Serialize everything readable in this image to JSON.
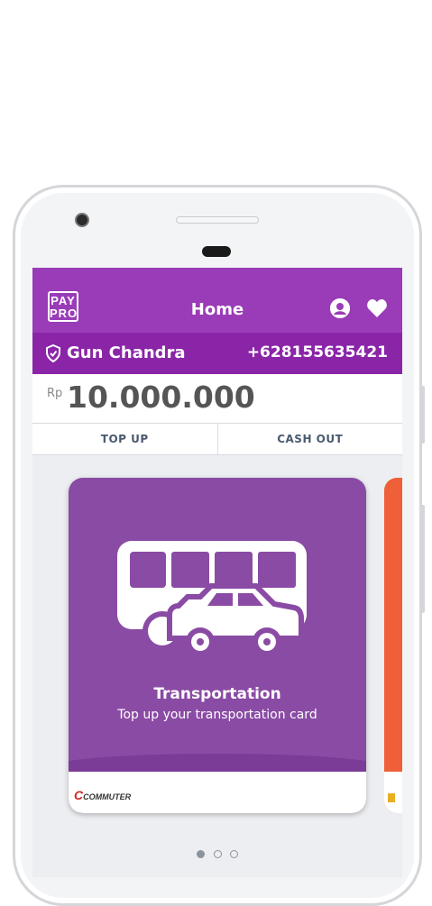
{
  "app": {
    "logo_text_line1": "PAY",
    "logo_text_line2": "PRO",
    "title": "Home",
    "brand_color": "#9a3cb7",
    "icons": [
      "profile-icon",
      "heart-icon",
      "shield-icon"
    ]
  },
  "user": {
    "name": "Gun Chandra",
    "phone": "+628155635421"
  },
  "balance": {
    "currency": "Rp",
    "amount": "10.000.000"
  },
  "actions": {
    "top_up": "TOP UP",
    "cash_out": "CASH OUT"
  },
  "cards": [
    {
      "title": "Transportation",
      "subtitle": "Top up your transportation card",
      "partner_logo": "COMMUTER",
      "color": "#8a4ba4"
    },
    {
      "color": "#ef5f38"
    }
  ],
  "pagination": {
    "count": 3,
    "active": 1
  }
}
